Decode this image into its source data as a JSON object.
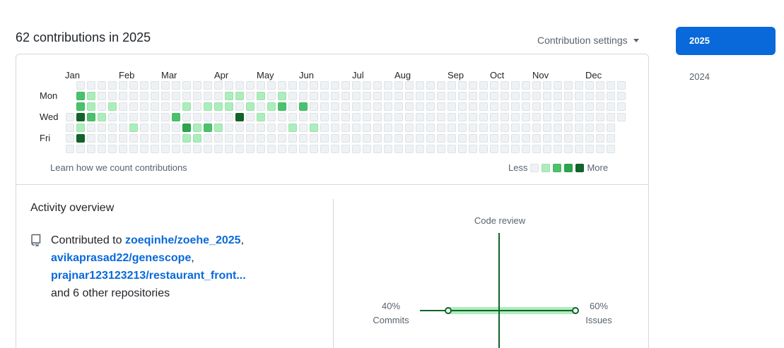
{
  "header": {
    "title": "62 contributions in 2025",
    "settings_label": "Contribution settings"
  },
  "graph": {
    "months": [
      "Jan",
      "Feb",
      "Mar",
      "Apr",
      "May",
      "Jun",
      "Jul",
      "Aug",
      "Sep",
      "Oct",
      "Nov",
      "Dec"
    ],
    "day_labels": [
      "Mon",
      "Wed",
      "Fri"
    ],
    "learn_link": "Learn how we count contributions",
    "legend_less": "Less",
    "legend_more": "More",
    "colors": [
      "#eff2f5",
      "#aceebb",
      "#4ac26b",
      "#2da44e",
      "#116329"
    ],
    "contributions": [
      {
        "week": 1,
        "day": 1,
        "level": 2
      },
      {
        "week": 1,
        "day": 2,
        "level": 2
      },
      {
        "week": 1,
        "day": 3,
        "level": 4
      },
      {
        "week": 1,
        "day": 4,
        "level": 1
      },
      {
        "week": 1,
        "day": 5,
        "level": 4
      },
      {
        "week": 2,
        "day": 1,
        "level": 1
      },
      {
        "week": 2,
        "day": 2,
        "level": 1
      },
      {
        "week": 2,
        "day": 3,
        "level": 2
      },
      {
        "week": 3,
        "day": 3,
        "level": 1
      },
      {
        "week": 4,
        "day": 2,
        "level": 1
      },
      {
        "week": 6,
        "day": 4,
        "level": 1
      },
      {
        "week": 10,
        "day": 3,
        "level": 2
      },
      {
        "week": 11,
        "day": 2,
        "level": 1
      },
      {
        "week": 11,
        "day": 4,
        "level": 3
      },
      {
        "week": 11,
        "day": 5,
        "level": 1
      },
      {
        "week": 12,
        "day": 4,
        "level": 1
      },
      {
        "week": 12,
        "day": 5,
        "level": 1
      },
      {
        "week": 13,
        "day": 2,
        "level": 1
      },
      {
        "week": 13,
        "day": 4,
        "level": 2
      },
      {
        "week": 14,
        "day": 2,
        "level": 1
      },
      {
        "week": 14,
        "day": 4,
        "level": 1
      },
      {
        "week": 15,
        "day": 1,
        "level": 1
      },
      {
        "week": 15,
        "day": 2,
        "level": 1
      },
      {
        "week": 16,
        "day": 1,
        "level": 1
      },
      {
        "week": 16,
        "day": 3,
        "level": 4
      },
      {
        "week": 17,
        "day": 2,
        "level": 1
      },
      {
        "week": 18,
        "day": 1,
        "level": 1
      },
      {
        "week": 18,
        "day": 3,
        "level": 1
      },
      {
        "week": 19,
        "day": 2,
        "level": 1
      },
      {
        "week": 20,
        "day": 1,
        "level": 1
      },
      {
        "week": 20,
        "day": 2,
        "level": 2
      },
      {
        "week": 21,
        "day": 4,
        "level": 1
      },
      {
        "week": 22,
        "day": 2,
        "level": 2
      },
      {
        "week": 23,
        "day": 4,
        "level": 1
      }
    ]
  },
  "activity": {
    "title": "Activity overview",
    "contributed_prefix": "Contributed to ",
    "repos": [
      "zoeqinhe/zoehe_2025",
      "avikaprasad22/genescope",
      "prajnar123123213/restaurant_front..."
    ],
    "sep1": ",",
    "sep2": ",",
    "others": "and 6 other repositories",
    "radar": {
      "top_label": "Code review",
      "left_percent": "40%",
      "left_label": "Commits",
      "right_percent": "60%",
      "right_label": "Issues",
      "left_value": 40,
      "right_value": 60,
      "top_value": 0,
      "bottom_value": 0,
      "color": "#116329",
      "fill": "#aceebb"
    }
  },
  "years": [
    {
      "label": "2025",
      "active": true
    },
    {
      "label": "2024",
      "active": false
    }
  ]
}
